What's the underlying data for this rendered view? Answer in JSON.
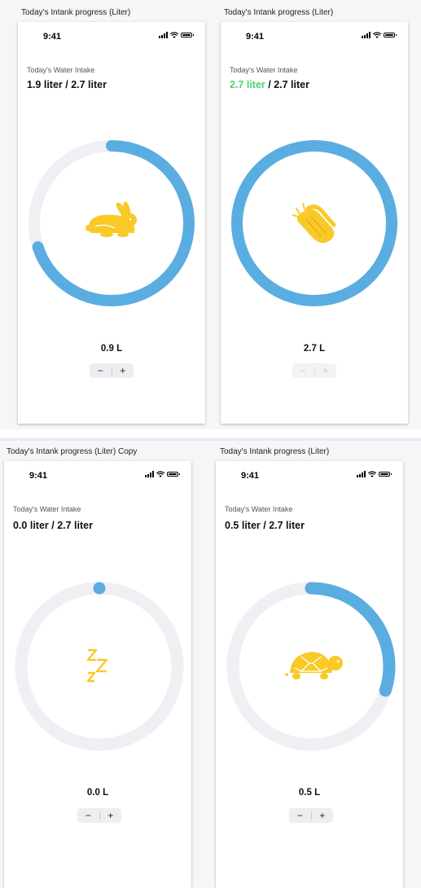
{
  "frames": [
    {
      "title": "Today's Intank progress (Liter)",
      "time": "9:41",
      "intake_label": "Today's Water Intake",
      "current": "1.9 liter",
      "separator": " / ",
      "goal": "2.7 liter",
      "amount": "0.9 L",
      "minus": "−",
      "plus": "+",
      "progress": 0.7,
      "icon": "rabbit-icon"
    },
    {
      "title": "Today's Intank progress (Liter)",
      "time": "9:41",
      "intake_label": "Today's Water Intake",
      "current": "2.7 liter",
      "separator": " / ",
      "goal": "2.7 liter",
      "amount": "2.7 L",
      "minus": "−",
      "plus": "+",
      "progress": 1.0,
      "icon": "clapping-hands-icon"
    },
    {
      "title": "Today's Intank progress (Liter) Copy",
      "time": "9:41",
      "intake_label": "Today's Water Intake",
      "current": "0.0 liter",
      "separator": " / ",
      "goal": "2.7 liter",
      "amount": "0.0 L",
      "minus": "−",
      "plus": "+",
      "progress": 0.0,
      "icon": "sleeping-zzz-icon"
    },
    {
      "title": "Today's Intank progress (Liter)",
      "time": "9:41",
      "intake_label": "Today's Water Intake",
      "current": "0.5 liter",
      "separator": " / ",
      "goal": "2.7 liter",
      "amount": "0.5 L",
      "minus": "−",
      "plus": "+",
      "progress": 0.3,
      "icon": "turtle-icon"
    }
  ],
  "colors": {
    "ring_track": "#efeff4",
    "ring_fill": "#5aade0",
    "icon": "#f9c928",
    "goal_reached": "#4cd370"
  }
}
